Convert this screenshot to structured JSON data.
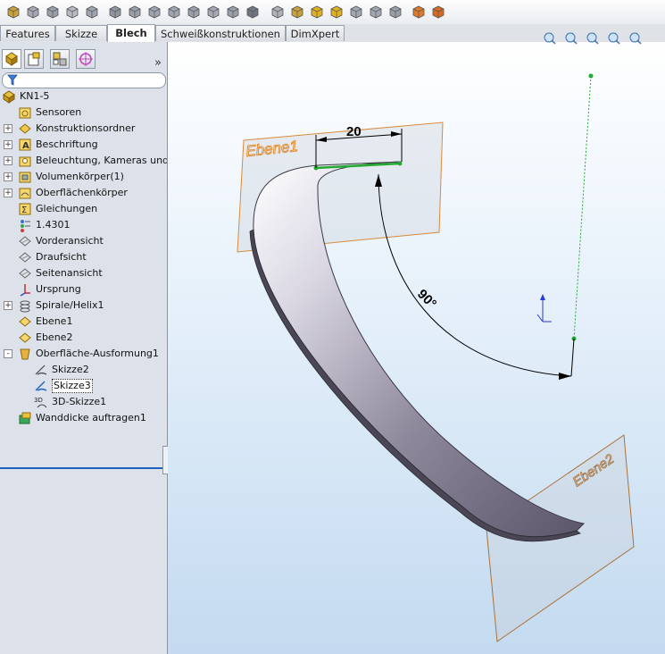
{
  "toolbar": {
    "icons": [
      "extruded-boss-icon",
      "revolved-boss-icon",
      "swept-boss-icon",
      "lofted-boss-icon",
      "boundary-boss-icon",
      "fillet-icon",
      "chamfer-icon",
      "rib-icon",
      "draft-icon",
      "shell-icon",
      "wrap-icon",
      "dome-icon",
      "reference-geometry-icon",
      "curves-icon",
      "instant3d-icon",
      "sheet-metal-base-icon",
      "sheet-metal-edge-icon",
      "flatten-icon",
      "unfold-icon",
      "fold-icon",
      "appearance-icon",
      "section-view-icon"
    ]
  },
  "tabs": [
    {
      "label": "Features",
      "active": false
    },
    {
      "label": "Skizze",
      "active": false
    },
    {
      "label": "Blech",
      "active": true
    },
    {
      "label": "Schweißkonstruktionen",
      "active": false
    },
    {
      "label": "DimXpert",
      "active": false
    }
  ],
  "panel": {
    "tabs": [
      "featuremanager-icon",
      "propertymanager-icon",
      "configurationmanager-icon",
      "dimxpertmanager-icon"
    ],
    "collapse_glyph": "»",
    "tree": [
      {
        "label": "KN1-5",
        "icon": "part-icon",
        "indent": 0,
        "expander": ""
      },
      {
        "label": "Sensoren",
        "icon": "sensors-folder-icon",
        "indent": 1,
        "expander": ""
      },
      {
        "label": "Konstruktionsordner",
        "icon": "design-binder-icon",
        "indent": 1,
        "expander": "+"
      },
      {
        "label": "Beschriftung",
        "icon": "annotations-icon",
        "indent": 1,
        "expander": "+"
      },
      {
        "label": "Beleuchtung, Kameras und Bil",
        "icon": "lights-cameras-icon",
        "indent": 1,
        "expander": "+"
      },
      {
        "label": "Volumenkörper(1)",
        "icon": "solid-bodies-icon",
        "indent": 1,
        "expander": "+"
      },
      {
        "label": "Oberflächenkörper",
        "icon": "surface-bodies-icon",
        "indent": 1,
        "expander": "+"
      },
      {
        "label": "Gleichungen",
        "icon": "equations-icon",
        "indent": 1,
        "expander": ""
      },
      {
        "label": "1.4301",
        "icon": "material-icon",
        "indent": 1,
        "expander": ""
      },
      {
        "label": "Vorderansicht",
        "icon": "plane-icon",
        "indent": 1,
        "expander": ""
      },
      {
        "label": "Draufsicht",
        "icon": "plane-icon",
        "indent": 1,
        "expander": ""
      },
      {
        "label": "Seitenansicht",
        "icon": "plane-icon",
        "indent": 1,
        "expander": ""
      },
      {
        "label": "Ursprung",
        "icon": "origin-icon",
        "indent": 1,
        "expander": ""
      },
      {
        "label": "Spirale/Helix1",
        "icon": "helix-icon",
        "indent": 1,
        "expander": "+"
      },
      {
        "label": "Ebene1",
        "icon": "plane-feature-icon",
        "indent": 1,
        "expander": ""
      },
      {
        "label": "Ebene2",
        "icon": "plane-feature-icon",
        "indent": 1,
        "expander": ""
      },
      {
        "label": "Oberfläche-Ausformung1",
        "icon": "surface-loft-icon",
        "indent": 1,
        "expander": "-"
      },
      {
        "label": "Skizze2",
        "icon": "sketch-icon",
        "indent": 2,
        "expander": ""
      },
      {
        "label": "Skizze3",
        "icon": "sketch-selected-icon",
        "indent": 2,
        "expander": "",
        "selected": true
      },
      {
        "label": "3D-Skizze1",
        "icon": "3d-sketch-icon",
        "indent": 2,
        "expander": ""
      },
      {
        "label": "Wanddicke auftragen1",
        "icon": "thicken-icon",
        "indent": 1,
        "expander": ""
      }
    ]
  },
  "viewport": {
    "heads_up_icons": [
      "zoom-to-fit-icon",
      "previous-view-icon",
      "section-view-icon",
      "view-orientation-icon",
      "display-style-icon"
    ],
    "plane1_label": "Ebene1",
    "plane2_label": "Ebene2",
    "dimension_width": "20",
    "dimension_angle": "90°",
    "colors": {
      "plane_edge": "#d98a3a",
      "part": "#8f8a9c",
      "sketch": "#22aa33"
    }
  }
}
